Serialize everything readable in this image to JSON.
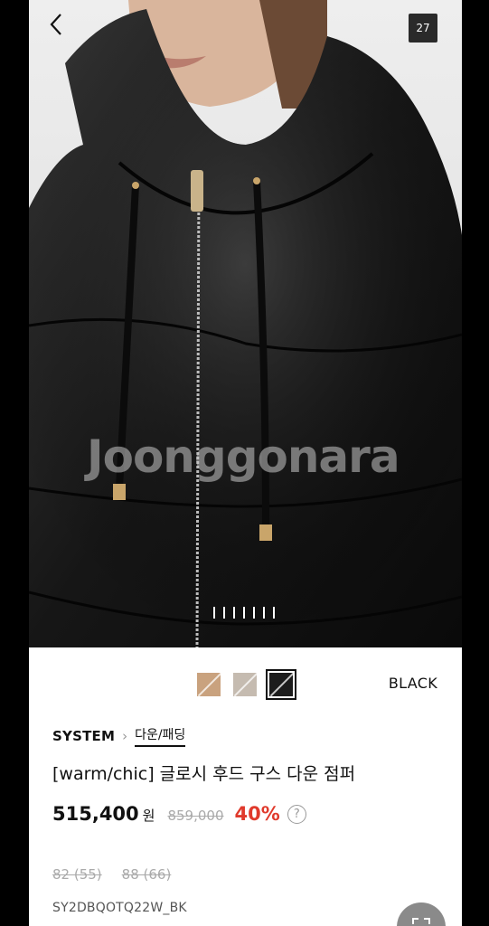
{
  "header": {
    "image_count": "27"
  },
  "hero": {
    "watermark": "Joonggonara",
    "pager_count": 7
  },
  "colors": {
    "swatches": [
      {
        "name": "camel",
        "hex": "#c9a27e"
      },
      {
        "name": "beige",
        "hex": "#c5bbb0"
      },
      {
        "name": "black",
        "hex": "#1c1c1c"
      }
    ],
    "selected_label": "BLACK"
  },
  "product": {
    "brand": "SYSTEM",
    "category": "다운/패딩",
    "title": "[warm/chic] 글로시 후드 구스 다운 점퍼",
    "price": "515,400",
    "currency": "원",
    "original_price": "859,000",
    "discount": "40%",
    "help_icon": "?",
    "sizes": [
      "82 (55)",
      "88 (66)"
    ],
    "sku": "SY2DBQOTQ22W_BK"
  },
  "theme": {
    "discount_color": "#e03a2c"
  }
}
